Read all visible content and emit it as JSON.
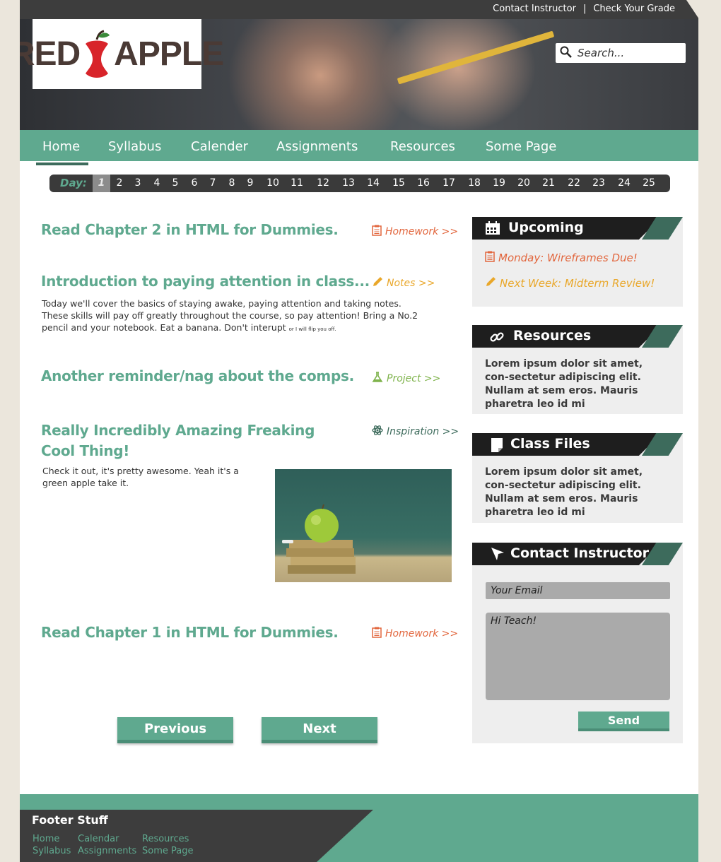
{
  "topbar": {
    "contact": "Contact Instructor",
    "grade": "Check Your Grade",
    "separator": "|"
  },
  "logo": {
    "left": "RED",
    "right": "APPLE"
  },
  "search": {
    "placeholder": "Search..."
  },
  "nav": {
    "items": [
      "Home",
      "Syllabus",
      "Calender",
      "Assignments",
      "Resources",
      "Some Page"
    ],
    "active": "Home"
  },
  "days": {
    "label": "Day:",
    "active": "1",
    "numbers": [
      "1",
      "2",
      "3",
      "4",
      "5",
      "6",
      "7",
      "8",
      "9",
      "10",
      "11",
      "12",
      "13",
      "14",
      "15",
      "16",
      "17",
      "18",
      "19",
      "20",
      "21",
      "22",
      "23",
      "24",
      "25"
    ]
  },
  "posts": [
    {
      "title": "Read Chapter 2 in HTML for Dummies.",
      "tag": "Homework >>",
      "tag_icon": "clipboard-icon"
    },
    {
      "title": "Introduction to paying attention in class...",
      "tag": "Notes >>",
      "tag_icon": "pencil-icon",
      "body": "Today we'll cover the basics of staying awake, paying attention and taking notes. These skills will pay off greatly throughout the course, so pay attention! Bring a No.2 pencil and your notebook. Eat a banana. Don't interupt",
      "body_small": "or I will flip you off."
    },
    {
      "title": "Another reminder/nag about the comps.",
      "tag": "Project >>",
      "tag_icon": "flask-icon"
    },
    {
      "title_line1": "Really Incredibly Amazing Freaking",
      "title_line2": "Cool Thing!",
      "tag": "Inspiration >>",
      "tag_icon": "atom-icon",
      "body": "Check it out, it's pretty awesome. Yeah it's a green apple take it."
    },
    {
      "title": "Read Chapter 1 in HTML for Dummies.",
      "tag": "Homework >>",
      "tag_icon": "clipboard-icon"
    }
  ],
  "pager": {
    "previous": "Previous",
    "next": "Next"
  },
  "sidebar": {
    "upcoming": {
      "title": "Upcoming",
      "items": [
        "Monday: Wireframes Due!",
        "Next Week: Midterm Review!"
      ]
    },
    "resources": {
      "title": "Resources",
      "text": "Lorem ipsum dolor sit amet, con-sectetur adipiscing elit. Nullam at sem eros. Mauris pharetra leo id mi"
    },
    "class_files": {
      "title": "Class Files",
      "text": "Lorem ipsum dolor sit amet, con-sectetur adipiscing elit. Nullam at sem eros. Mauris pharetra leo id mi"
    },
    "contact": {
      "title": "Contact Instructor",
      "email_placeholder": "Your Email",
      "message_placeholder": "Hi Teach!",
      "send": "Send"
    }
  },
  "footer": {
    "title": "Footer Stuff",
    "links": [
      "Home",
      "Syllabus",
      "Calendar",
      "Assignments",
      "Resources",
      "Some Page"
    ]
  },
  "colors": {
    "accent": "#5fa98f",
    "dark": "#3d3d3d",
    "orange": "#e2663d",
    "yellow": "#e9a72a",
    "green": "#7fb34c"
  }
}
